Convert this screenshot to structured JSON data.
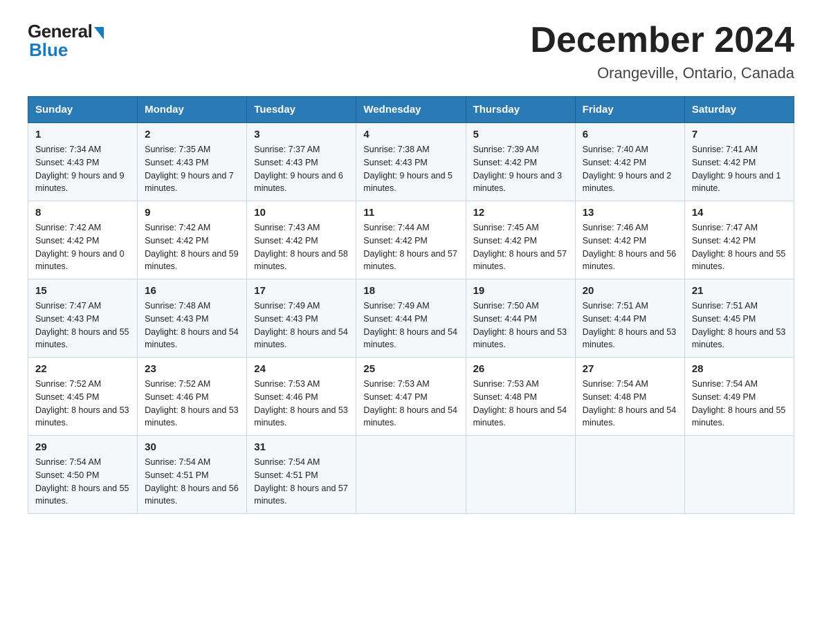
{
  "header": {
    "logo_general": "General",
    "logo_blue": "Blue",
    "month_title": "December 2024",
    "location": "Orangeville, Ontario, Canada"
  },
  "days_of_week": [
    "Sunday",
    "Monday",
    "Tuesday",
    "Wednesday",
    "Thursday",
    "Friday",
    "Saturday"
  ],
  "weeks": [
    [
      {
        "day": "1",
        "sunrise": "7:34 AM",
        "sunset": "4:43 PM",
        "daylight": "9 hours and 9 minutes."
      },
      {
        "day": "2",
        "sunrise": "7:35 AM",
        "sunset": "4:43 PM",
        "daylight": "9 hours and 7 minutes."
      },
      {
        "day": "3",
        "sunrise": "7:37 AM",
        "sunset": "4:43 PM",
        "daylight": "9 hours and 6 minutes."
      },
      {
        "day": "4",
        "sunrise": "7:38 AM",
        "sunset": "4:43 PM",
        "daylight": "9 hours and 5 minutes."
      },
      {
        "day": "5",
        "sunrise": "7:39 AM",
        "sunset": "4:42 PM",
        "daylight": "9 hours and 3 minutes."
      },
      {
        "day": "6",
        "sunrise": "7:40 AM",
        "sunset": "4:42 PM",
        "daylight": "9 hours and 2 minutes."
      },
      {
        "day": "7",
        "sunrise": "7:41 AM",
        "sunset": "4:42 PM",
        "daylight": "9 hours and 1 minute."
      }
    ],
    [
      {
        "day": "8",
        "sunrise": "7:42 AM",
        "sunset": "4:42 PM",
        "daylight": "9 hours and 0 minutes."
      },
      {
        "day": "9",
        "sunrise": "7:42 AM",
        "sunset": "4:42 PM",
        "daylight": "8 hours and 59 minutes."
      },
      {
        "day": "10",
        "sunrise": "7:43 AM",
        "sunset": "4:42 PM",
        "daylight": "8 hours and 58 minutes."
      },
      {
        "day": "11",
        "sunrise": "7:44 AM",
        "sunset": "4:42 PM",
        "daylight": "8 hours and 57 minutes."
      },
      {
        "day": "12",
        "sunrise": "7:45 AM",
        "sunset": "4:42 PM",
        "daylight": "8 hours and 57 minutes."
      },
      {
        "day": "13",
        "sunrise": "7:46 AM",
        "sunset": "4:42 PM",
        "daylight": "8 hours and 56 minutes."
      },
      {
        "day": "14",
        "sunrise": "7:47 AM",
        "sunset": "4:42 PM",
        "daylight": "8 hours and 55 minutes."
      }
    ],
    [
      {
        "day": "15",
        "sunrise": "7:47 AM",
        "sunset": "4:43 PM",
        "daylight": "8 hours and 55 minutes."
      },
      {
        "day": "16",
        "sunrise": "7:48 AM",
        "sunset": "4:43 PM",
        "daylight": "8 hours and 54 minutes."
      },
      {
        "day": "17",
        "sunrise": "7:49 AM",
        "sunset": "4:43 PM",
        "daylight": "8 hours and 54 minutes."
      },
      {
        "day": "18",
        "sunrise": "7:49 AM",
        "sunset": "4:44 PM",
        "daylight": "8 hours and 54 minutes."
      },
      {
        "day": "19",
        "sunrise": "7:50 AM",
        "sunset": "4:44 PM",
        "daylight": "8 hours and 53 minutes."
      },
      {
        "day": "20",
        "sunrise": "7:51 AM",
        "sunset": "4:44 PM",
        "daylight": "8 hours and 53 minutes."
      },
      {
        "day": "21",
        "sunrise": "7:51 AM",
        "sunset": "4:45 PM",
        "daylight": "8 hours and 53 minutes."
      }
    ],
    [
      {
        "day": "22",
        "sunrise": "7:52 AM",
        "sunset": "4:45 PM",
        "daylight": "8 hours and 53 minutes."
      },
      {
        "day": "23",
        "sunrise": "7:52 AM",
        "sunset": "4:46 PM",
        "daylight": "8 hours and 53 minutes."
      },
      {
        "day": "24",
        "sunrise": "7:53 AM",
        "sunset": "4:46 PM",
        "daylight": "8 hours and 53 minutes."
      },
      {
        "day": "25",
        "sunrise": "7:53 AM",
        "sunset": "4:47 PM",
        "daylight": "8 hours and 54 minutes."
      },
      {
        "day": "26",
        "sunrise": "7:53 AM",
        "sunset": "4:48 PM",
        "daylight": "8 hours and 54 minutes."
      },
      {
        "day": "27",
        "sunrise": "7:54 AM",
        "sunset": "4:48 PM",
        "daylight": "8 hours and 54 minutes."
      },
      {
        "day": "28",
        "sunrise": "7:54 AM",
        "sunset": "4:49 PM",
        "daylight": "8 hours and 55 minutes."
      }
    ],
    [
      {
        "day": "29",
        "sunrise": "7:54 AM",
        "sunset": "4:50 PM",
        "daylight": "8 hours and 55 minutes."
      },
      {
        "day": "30",
        "sunrise": "7:54 AM",
        "sunset": "4:51 PM",
        "daylight": "8 hours and 56 minutes."
      },
      {
        "day": "31",
        "sunrise": "7:54 AM",
        "sunset": "4:51 PM",
        "daylight": "8 hours and 57 minutes."
      },
      null,
      null,
      null,
      null
    ]
  ],
  "labels": {
    "sunrise": "Sunrise:",
    "sunset": "Sunset:",
    "daylight": "Daylight:"
  }
}
